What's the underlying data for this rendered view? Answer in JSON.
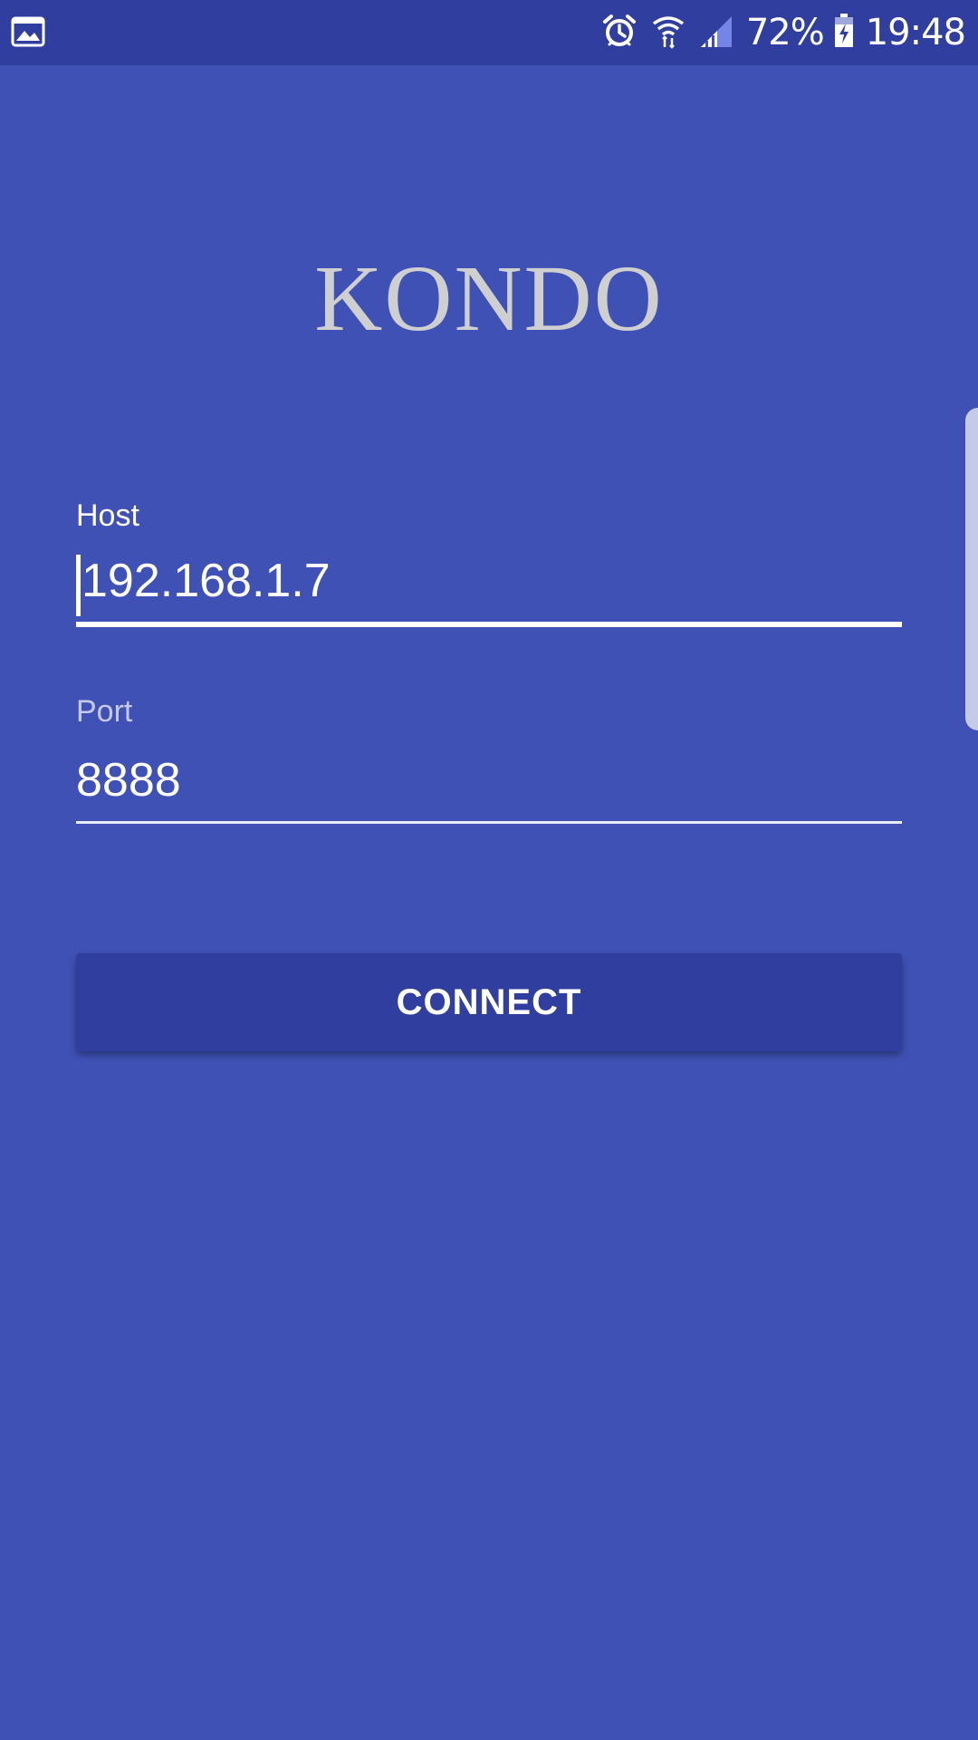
{
  "status_bar": {
    "left_icon": "image-icon",
    "icons": [
      "alarm-icon",
      "wifi-icon",
      "signal-icon",
      "battery-charging-icon"
    ],
    "battery_percent": "72%",
    "time": "19:48"
  },
  "app": {
    "logo_text": "KONDO"
  },
  "form": {
    "host": {
      "label": "Host",
      "value": "192.168.1.7"
    },
    "port": {
      "label": "Port",
      "value": "8888"
    },
    "connect_label": "CONNECT"
  },
  "colors": {
    "background": "#3f51b5",
    "status_bar": "#303f9f",
    "button": "#303f9f",
    "logo": "#cfcfcf",
    "text": "#ffffff"
  }
}
